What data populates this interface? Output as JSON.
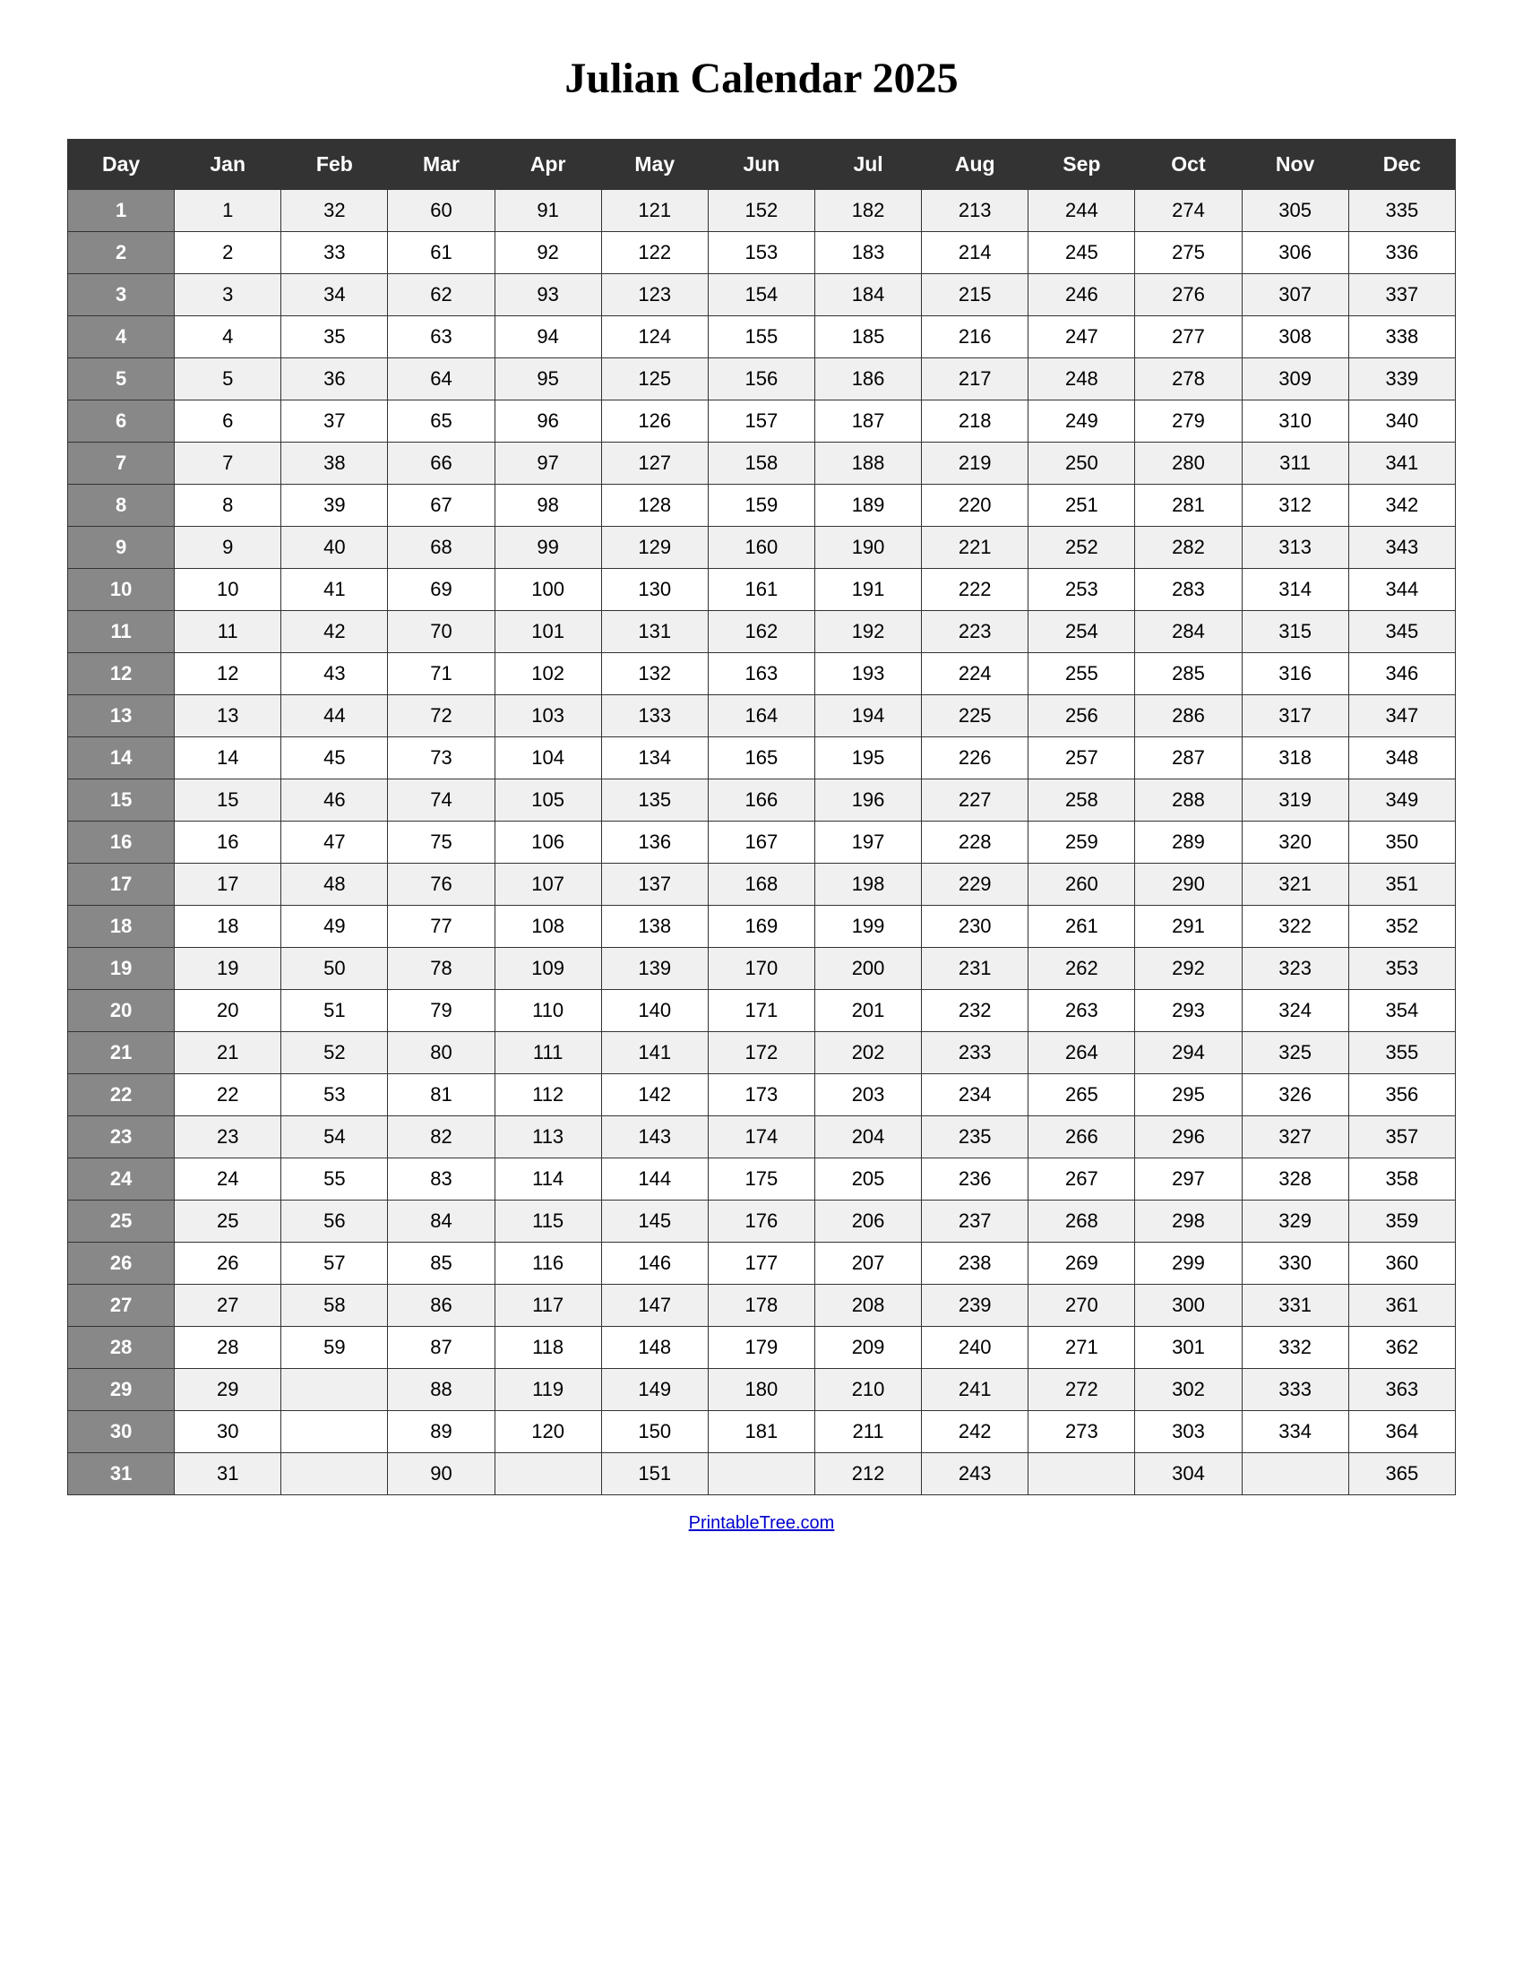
{
  "title": "Julian Calendar 2025",
  "headers": [
    "Day",
    "Jan",
    "Feb",
    "Mar",
    "Apr",
    "May",
    "Jun",
    "Jul",
    "Aug",
    "Sep",
    "Oct",
    "Nov",
    "Dec"
  ],
  "rows": [
    [
      1,
      1,
      32,
      60,
      91,
      121,
      152,
      182,
      213,
      244,
      274,
      305,
      335
    ],
    [
      2,
      2,
      33,
      61,
      92,
      122,
      153,
      183,
      214,
      245,
      275,
      306,
      336
    ],
    [
      3,
      3,
      34,
      62,
      93,
      123,
      154,
      184,
      215,
      246,
      276,
      307,
      337
    ],
    [
      4,
      4,
      35,
      63,
      94,
      124,
      155,
      185,
      216,
      247,
      277,
      308,
      338
    ],
    [
      5,
      5,
      36,
      64,
      95,
      125,
      156,
      186,
      217,
      248,
      278,
      309,
      339
    ],
    [
      6,
      6,
      37,
      65,
      96,
      126,
      157,
      187,
      218,
      249,
      279,
      310,
      340
    ],
    [
      7,
      7,
      38,
      66,
      97,
      127,
      158,
      188,
      219,
      250,
      280,
      311,
      341
    ],
    [
      8,
      8,
      39,
      67,
      98,
      128,
      159,
      189,
      220,
      251,
      281,
      312,
      342
    ],
    [
      9,
      9,
      40,
      68,
      99,
      129,
      160,
      190,
      221,
      252,
      282,
      313,
      343
    ],
    [
      10,
      10,
      41,
      69,
      100,
      130,
      161,
      191,
      222,
      253,
      283,
      314,
      344
    ],
    [
      11,
      11,
      42,
      70,
      101,
      131,
      162,
      192,
      223,
      254,
      284,
      315,
      345
    ],
    [
      12,
      12,
      43,
      71,
      102,
      132,
      163,
      193,
      224,
      255,
      285,
      316,
      346
    ],
    [
      13,
      13,
      44,
      72,
      103,
      133,
      164,
      194,
      225,
      256,
      286,
      317,
      347
    ],
    [
      14,
      14,
      45,
      73,
      104,
      134,
      165,
      195,
      226,
      257,
      287,
      318,
      348
    ],
    [
      15,
      15,
      46,
      74,
      105,
      135,
      166,
      196,
      227,
      258,
      288,
      319,
      349
    ],
    [
      16,
      16,
      47,
      75,
      106,
      136,
      167,
      197,
      228,
      259,
      289,
      320,
      350
    ],
    [
      17,
      17,
      48,
      76,
      107,
      137,
      168,
      198,
      229,
      260,
      290,
      321,
      351
    ],
    [
      18,
      18,
      49,
      77,
      108,
      138,
      169,
      199,
      230,
      261,
      291,
      322,
      352
    ],
    [
      19,
      19,
      50,
      78,
      109,
      139,
      170,
      200,
      231,
      262,
      292,
      323,
      353
    ],
    [
      20,
      20,
      51,
      79,
      110,
      140,
      171,
      201,
      232,
      263,
      293,
      324,
      354
    ],
    [
      21,
      21,
      52,
      80,
      111,
      141,
      172,
      202,
      233,
      264,
      294,
      325,
      355
    ],
    [
      22,
      22,
      53,
      81,
      112,
      142,
      173,
      203,
      234,
      265,
      295,
      326,
      356
    ],
    [
      23,
      23,
      54,
      82,
      113,
      143,
      174,
      204,
      235,
      266,
      296,
      327,
      357
    ],
    [
      24,
      24,
      55,
      83,
      114,
      144,
      175,
      205,
      236,
      267,
      297,
      328,
      358
    ],
    [
      25,
      25,
      56,
      84,
      115,
      145,
      176,
      206,
      237,
      268,
      298,
      329,
      359
    ],
    [
      26,
      26,
      57,
      85,
      116,
      146,
      177,
      207,
      238,
      269,
      299,
      330,
      360
    ],
    [
      27,
      27,
      58,
      86,
      117,
      147,
      178,
      208,
      239,
      270,
      300,
      331,
      361
    ],
    [
      28,
      28,
      59,
      87,
      118,
      148,
      179,
      209,
      240,
      271,
      301,
      332,
      362
    ],
    [
      29,
      29,
      "",
      88,
      119,
      149,
      180,
      210,
      241,
      272,
      302,
      333,
      363
    ],
    [
      30,
      30,
      "",
      89,
      120,
      150,
      181,
      211,
      242,
      273,
      303,
      334,
      364
    ],
    [
      31,
      31,
      "",
      90,
      "",
      151,
      "",
      212,
      243,
      "",
      304,
      "",
      365
    ]
  ],
  "footer_link": "PrintableTree.com"
}
